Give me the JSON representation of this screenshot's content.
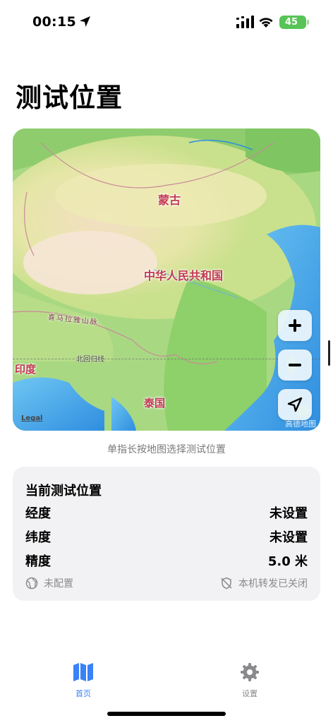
{
  "status_bar": {
    "time": "00:15",
    "battery": "45",
    "icons": [
      "location-arrow-icon",
      "signal-icon",
      "wifi-icon",
      "battery-icon"
    ]
  },
  "page": {
    "title": "测试位置"
  },
  "map": {
    "labels": {
      "mongolia": "蒙古",
      "china": "中华人民共和国",
      "india": "印度",
      "thailand": "泰国",
      "himalaya": "喜马拉雅山脉",
      "tropic": "北回归线"
    },
    "legal": "Legal",
    "attribution": "高德地图",
    "controls": [
      "plus-icon",
      "minus-icon",
      "location-arrow-icon"
    ]
  },
  "hint": "单指长按地图选择测试位置",
  "location_card": {
    "title": "当前测试位置",
    "rows": [
      {
        "label": "经度",
        "value": "未设置"
      },
      {
        "label": "纬度",
        "value": "未设置"
      },
      {
        "label": "精度",
        "value": "5.0 米"
      }
    ],
    "config_status": "未配置",
    "forward_status": "本机转发已关闭"
  },
  "tabs": [
    {
      "label": "首页",
      "icon": "map-icon",
      "active": true
    },
    {
      "label": "设置",
      "icon": "gear-icon",
      "active": false
    }
  ],
  "colors": {
    "accent": "#3a82f7",
    "map_label": "#c23a54",
    "battery": "#58c457"
  }
}
